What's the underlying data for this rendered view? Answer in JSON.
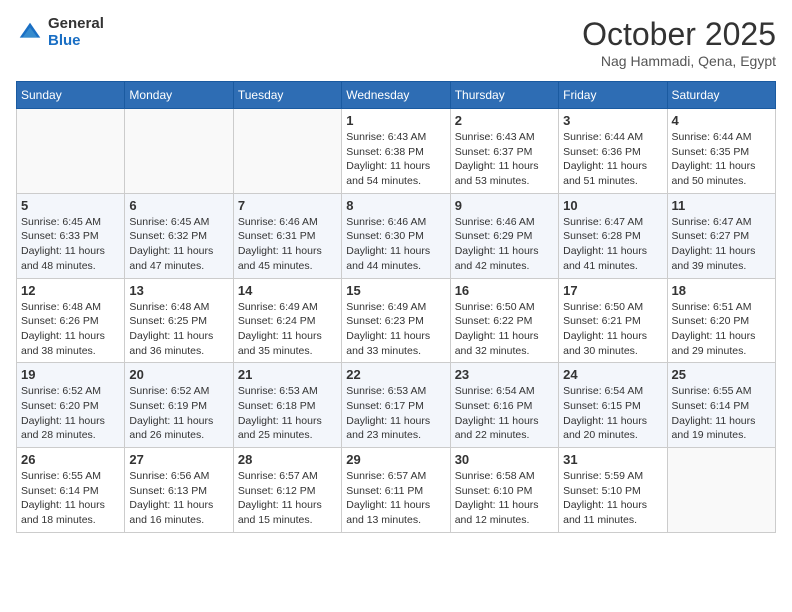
{
  "header": {
    "logo_general": "General",
    "logo_blue": "Blue",
    "month_title": "October 2025",
    "location": "Nag Hammadi, Qena, Egypt"
  },
  "weekdays": [
    "Sunday",
    "Monday",
    "Tuesday",
    "Wednesday",
    "Thursday",
    "Friday",
    "Saturday"
  ],
  "weeks": [
    [
      {
        "day": "",
        "info": ""
      },
      {
        "day": "",
        "info": ""
      },
      {
        "day": "",
        "info": ""
      },
      {
        "day": "1",
        "sunrise": "Sunrise: 6:43 AM",
        "sunset": "Sunset: 6:38 PM",
        "daylight": "Daylight: 11 hours and 54 minutes."
      },
      {
        "day": "2",
        "sunrise": "Sunrise: 6:43 AM",
        "sunset": "Sunset: 6:37 PM",
        "daylight": "Daylight: 11 hours and 53 minutes."
      },
      {
        "day": "3",
        "sunrise": "Sunrise: 6:44 AM",
        "sunset": "Sunset: 6:36 PM",
        "daylight": "Daylight: 11 hours and 51 minutes."
      },
      {
        "day": "4",
        "sunrise": "Sunrise: 6:44 AM",
        "sunset": "Sunset: 6:35 PM",
        "daylight": "Daylight: 11 hours and 50 minutes."
      }
    ],
    [
      {
        "day": "5",
        "sunrise": "Sunrise: 6:45 AM",
        "sunset": "Sunset: 6:33 PM",
        "daylight": "Daylight: 11 hours and 48 minutes."
      },
      {
        "day": "6",
        "sunrise": "Sunrise: 6:45 AM",
        "sunset": "Sunset: 6:32 PM",
        "daylight": "Daylight: 11 hours and 47 minutes."
      },
      {
        "day": "7",
        "sunrise": "Sunrise: 6:46 AM",
        "sunset": "Sunset: 6:31 PM",
        "daylight": "Daylight: 11 hours and 45 minutes."
      },
      {
        "day": "8",
        "sunrise": "Sunrise: 6:46 AM",
        "sunset": "Sunset: 6:30 PM",
        "daylight": "Daylight: 11 hours and 44 minutes."
      },
      {
        "day": "9",
        "sunrise": "Sunrise: 6:46 AM",
        "sunset": "Sunset: 6:29 PM",
        "daylight": "Daylight: 11 hours and 42 minutes."
      },
      {
        "day": "10",
        "sunrise": "Sunrise: 6:47 AM",
        "sunset": "Sunset: 6:28 PM",
        "daylight": "Daylight: 11 hours and 41 minutes."
      },
      {
        "day": "11",
        "sunrise": "Sunrise: 6:47 AM",
        "sunset": "Sunset: 6:27 PM",
        "daylight": "Daylight: 11 hours and 39 minutes."
      }
    ],
    [
      {
        "day": "12",
        "sunrise": "Sunrise: 6:48 AM",
        "sunset": "Sunset: 6:26 PM",
        "daylight": "Daylight: 11 hours and 38 minutes."
      },
      {
        "day": "13",
        "sunrise": "Sunrise: 6:48 AM",
        "sunset": "Sunset: 6:25 PM",
        "daylight": "Daylight: 11 hours and 36 minutes."
      },
      {
        "day": "14",
        "sunrise": "Sunrise: 6:49 AM",
        "sunset": "Sunset: 6:24 PM",
        "daylight": "Daylight: 11 hours and 35 minutes."
      },
      {
        "day": "15",
        "sunrise": "Sunrise: 6:49 AM",
        "sunset": "Sunset: 6:23 PM",
        "daylight": "Daylight: 11 hours and 33 minutes."
      },
      {
        "day": "16",
        "sunrise": "Sunrise: 6:50 AM",
        "sunset": "Sunset: 6:22 PM",
        "daylight": "Daylight: 11 hours and 32 minutes."
      },
      {
        "day": "17",
        "sunrise": "Sunrise: 6:50 AM",
        "sunset": "Sunset: 6:21 PM",
        "daylight": "Daylight: 11 hours and 30 minutes."
      },
      {
        "day": "18",
        "sunrise": "Sunrise: 6:51 AM",
        "sunset": "Sunset: 6:20 PM",
        "daylight": "Daylight: 11 hours and 29 minutes."
      }
    ],
    [
      {
        "day": "19",
        "sunrise": "Sunrise: 6:52 AM",
        "sunset": "Sunset: 6:20 PM",
        "daylight": "Daylight: 11 hours and 28 minutes."
      },
      {
        "day": "20",
        "sunrise": "Sunrise: 6:52 AM",
        "sunset": "Sunset: 6:19 PM",
        "daylight": "Daylight: 11 hours and 26 minutes."
      },
      {
        "day": "21",
        "sunrise": "Sunrise: 6:53 AM",
        "sunset": "Sunset: 6:18 PM",
        "daylight": "Daylight: 11 hours and 25 minutes."
      },
      {
        "day": "22",
        "sunrise": "Sunrise: 6:53 AM",
        "sunset": "Sunset: 6:17 PM",
        "daylight": "Daylight: 11 hours and 23 minutes."
      },
      {
        "day": "23",
        "sunrise": "Sunrise: 6:54 AM",
        "sunset": "Sunset: 6:16 PM",
        "daylight": "Daylight: 11 hours and 22 minutes."
      },
      {
        "day": "24",
        "sunrise": "Sunrise: 6:54 AM",
        "sunset": "Sunset: 6:15 PM",
        "daylight": "Daylight: 11 hours and 20 minutes."
      },
      {
        "day": "25",
        "sunrise": "Sunrise: 6:55 AM",
        "sunset": "Sunset: 6:14 PM",
        "daylight": "Daylight: 11 hours and 19 minutes."
      }
    ],
    [
      {
        "day": "26",
        "sunrise": "Sunrise: 6:55 AM",
        "sunset": "Sunset: 6:14 PM",
        "daylight": "Daylight: 11 hours and 18 minutes."
      },
      {
        "day": "27",
        "sunrise": "Sunrise: 6:56 AM",
        "sunset": "Sunset: 6:13 PM",
        "daylight": "Daylight: 11 hours and 16 minutes."
      },
      {
        "day": "28",
        "sunrise": "Sunrise: 6:57 AM",
        "sunset": "Sunset: 6:12 PM",
        "daylight": "Daylight: 11 hours and 15 minutes."
      },
      {
        "day": "29",
        "sunrise": "Sunrise: 6:57 AM",
        "sunset": "Sunset: 6:11 PM",
        "daylight": "Daylight: 11 hours and 13 minutes."
      },
      {
        "day": "30",
        "sunrise": "Sunrise: 6:58 AM",
        "sunset": "Sunset: 6:10 PM",
        "daylight": "Daylight: 11 hours and 12 minutes."
      },
      {
        "day": "31",
        "sunrise": "Sunrise: 5:59 AM",
        "sunset": "Sunset: 5:10 PM",
        "daylight": "Daylight: 11 hours and 11 minutes."
      },
      {
        "day": "",
        "info": ""
      }
    ]
  ]
}
